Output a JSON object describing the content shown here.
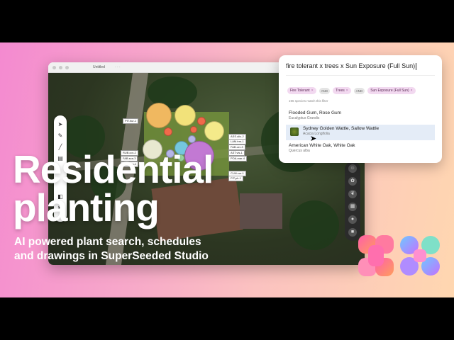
{
  "app": {
    "window_title": "Untitled",
    "file_label": "· · ·"
  },
  "map_tags": {
    "left": [
      "PIT.hur-1",
      "RUB.cor-2",
      "FAB.sca-3",
      "RUT.nan-1"
    ],
    "right": [
      "ASS.ulic-2",
      "LAM.trm-1",
      "FAB.cer-3",
      "AST.vis-1",
      "POA.mar-4",
      "CUN.cor-1",
      "PIT.ph-1"
    ]
  },
  "toolbar_left_icons": [
    "pointer-icon",
    "pen-icon",
    "line-icon",
    "trash-icon",
    "layers-icon",
    "image-icon"
  ],
  "toolbar_right_icons": [
    "people-icon",
    "plant-icon",
    "leaf-icon",
    "grid-icon",
    "circle-icon",
    "square-icon"
  ],
  "search": {
    "query": "fire tolerant x trees x Sun Exposure (Full Sun)",
    "chips": [
      "Fire Tolerant",
      "Trees",
      "Sun Exposure (Full Sun)"
    ],
    "and_label": "AND",
    "match_count": "196 species match this filter",
    "results": [
      {
        "name": "Flooded Gum, Rose Gum",
        "latin": "Eucalyptus Grandis"
      },
      {
        "name": "Sydney Golden Wattle, Sallow Wattle",
        "latin": "Acacia Longifolia"
      },
      {
        "name": "American White Oak, White Oak",
        "latin": "Quercus alba"
      }
    ]
  },
  "headline": {
    "line1": "Residential",
    "line2": "planting"
  },
  "subtitle": {
    "line1": "AI powered plant search, schedules",
    "line2": "and drawings in SuperSeeded Studio"
  },
  "colors": {
    "banner_start": "#f48ad0",
    "banner_end": "#ffd7b0",
    "logo_pink": "#ff5fa8",
    "logo_orange": "#ff9e5c",
    "logo_purple": "#c470ff",
    "logo_blue": "#6ec8ff"
  }
}
